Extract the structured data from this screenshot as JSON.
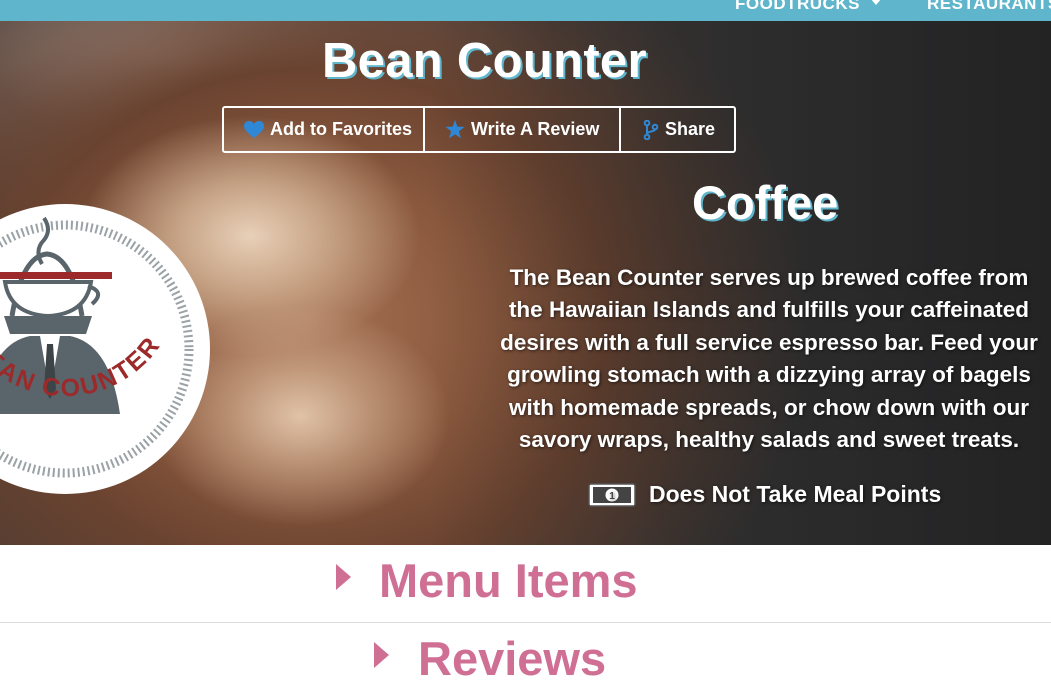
{
  "nav": {
    "foodtrucks_label": "FOODTRUCKS",
    "restaurants_label": "RESTAURANTS",
    "caret_icon": "chevron-down-icon"
  },
  "business": {
    "name": "Bean Counter",
    "category": "Coffee",
    "description": "The Bean Counter serves up brewed coffee from the Hawaiian Islands and fulfills your caffeinated desires with a full service espresso bar. Feed your growling stomach with a dizzying array of bagels with homemade spreads, or chow down with our savory wraps, healthy salads and sweet treats.",
    "meal_points": "Does Not Take Meal Points",
    "logo_text": "BEAN COUNTER"
  },
  "actions": {
    "favorites_label": "Add to Favorites",
    "favorites_icon": "heart-icon",
    "review_label": "Write A Review",
    "review_icon": "star-icon",
    "share_label": "Share",
    "share_icon": "share-branch-icon"
  },
  "sections": {
    "menu_label": "Menu Items",
    "reviews_label": "Reviews"
  },
  "colors": {
    "nav_bg": "#5fb6cc",
    "accent_pink": "#cf6f94",
    "icon_blue": "#2e88d6",
    "logo_red": "#9c2a2a",
    "logo_gray": "#5a646b"
  }
}
